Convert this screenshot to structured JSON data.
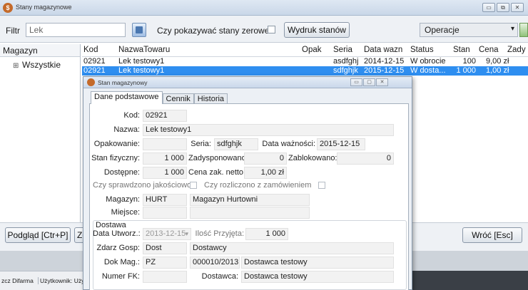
{
  "window": {
    "title": "Stany magazynowe",
    "buttons": [
      "▭",
      "⧉",
      "✕"
    ]
  },
  "toolbar": {
    "filtr_label": "Filtr",
    "filtr_value": "Lek",
    "zerowe_label": "Czy pokazywać stany zerowe",
    "wydruk_label": "Wydruk stanów",
    "operacje_value": "Operacje"
  },
  "left_panel": {
    "header": "Magazyn",
    "tree_item": "Wszystkie"
  },
  "grid": {
    "headers": {
      "kod": "Kod",
      "nazwa": "NazwaTowaru",
      "opak": "Opak",
      "seria": "Seria",
      "data": "Data wazn",
      "status": "Status",
      "stan": "Stan",
      "cena": "Cena",
      "zad": "Zady"
    },
    "rows": [
      {
        "kod": "02921",
        "nazwa": "Lek testowy1",
        "opak": "",
        "seria": "asdfghj",
        "data": "2014-12-15",
        "status": "W obrocie",
        "stan": "100",
        "cena": "9,00 zł",
        "zad": ""
      },
      {
        "kod": "02921",
        "nazwa": "Lek testowy1",
        "opak": "",
        "seria": "sdfghjk",
        "data": "2015-12-15",
        "status": "W dosta...",
        "stan": "1 000",
        "cena": "1,00 zł",
        "zad": ""
      }
    ]
  },
  "bottom": {
    "podglad_label": "Podgląd [Ctr+P]",
    "zg_label": "Zg",
    "wroc_label": "Wróć [Esc]"
  },
  "statusbar": {
    "company": "zcz Difarma",
    "user": "Użytkownik: Użytk"
  },
  "dialog": {
    "title": "Stan magazynowy",
    "tabs": [
      "Dane podstawowe",
      "Cennik",
      "Historia"
    ],
    "kod_label": "Kod:",
    "kod_value": "02921",
    "nazwa_label": "Nazwa:",
    "nazwa_value": "Lek testowy1",
    "opak_label": "Opakowanie:",
    "opak_value": "",
    "seria_label": "Seria:",
    "seria_value": "sdfghjk",
    "data_label": "Data ważności:",
    "data_value": "2015-12-15",
    "stan_fiz_label": "Stan fizyczny:",
    "stan_fiz_value": "1 000",
    "zadys_label": "Zadysponowano:",
    "zadys_value": "0",
    "zablok_label": "Zablokowano:",
    "zablok_value": "0",
    "dostepne_label": "Dostępne:",
    "dostepne_value": "1 000",
    "cena_label": "Cena zak. netto:",
    "cena_value": "1,00 zł",
    "sprawdz_label": "Czy sprawdzono jakościowo",
    "rozlicz_label": "Czy rozliczono z zamówieniem",
    "magazyn_label": "Magazyn:",
    "magazyn_code": "HURT",
    "magazyn_name": "Magazyn Hurtowni",
    "miejsce_label": "Miejsce:",
    "dostawa_label": "Dostawa",
    "data_utw_label": "Data Utworz.:",
    "data_utw_value": "2013-12-15",
    "ilosc_label": "Ilość Przyjęta:",
    "ilosc_value": "1 000",
    "zdarz_label": "Zdarz Gosp:",
    "zdarz_code": "Dost",
    "zdarz_name": "Dostawcy",
    "dokmag_label": "Dok Mag.:",
    "dokmag_code": "PZ",
    "dokmag_num": "000010/2013",
    "dokmag_name": "Dostawca testowy",
    "numerfk_label": "Numer FK:",
    "numerfk_value": "",
    "dostawca_label": "Dostawca:",
    "dostawca_value": "Dostawca testowy"
  }
}
